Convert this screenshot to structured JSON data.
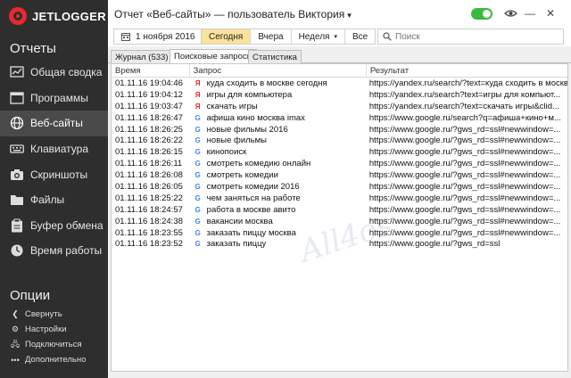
{
  "app": {
    "logo_text": "JETLOGGER"
  },
  "sidebar": {
    "reports_title": "Отчеты",
    "items": [
      {
        "label": "Общая сводка",
        "icon": "summary-icon",
        "active": false
      },
      {
        "label": "Программы",
        "icon": "programs-icon",
        "active": false
      },
      {
        "label": "Веб-сайты",
        "icon": "globe-icon",
        "active": true
      },
      {
        "label": "Клавиатура",
        "icon": "keyboard-icon",
        "active": false
      },
      {
        "label": "Скриншоты",
        "icon": "camera-icon",
        "active": false
      },
      {
        "label": "Файлы",
        "icon": "folder-icon",
        "active": false
      },
      {
        "label": "Буфер обмена",
        "icon": "clipboard-icon",
        "active": false
      },
      {
        "label": "Время работы",
        "icon": "clock-icon",
        "active": false
      }
    ],
    "options_title": "Опции",
    "options": [
      {
        "label": "Свернуть",
        "icon": "chevron-left-icon"
      },
      {
        "label": "Настройки",
        "icon": "gear-icon"
      },
      {
        "label": "Подключиться",
        "icon": "connect-icon"
      },
      {
        "label": "Дополнительно",
        "icon": "more-icon"
      }
    ]
  },
  "header": {
    "title": "Отчет «Веб-сайты» — пользователь ",
    "user": "Виктория",
    "toggle_on": true,
    "accent": "#3cb93c"
  },
  "toolbar": {
    "date": "1 ноября 2016",
    "today": "Сегодня",
    "yesterday": "Вчера",
    "week": "Неделя",
    "all": "Все",
    "search_placeholder": "Поиск",
    "active_color": "#fbe29a"
  },
  "tabs": [
    {
      "label": "Журнал (533)",
      "active": false
    },
    {
      "label": "Поисковые запросы",
      "active": true
    },
    {
      "label": "Статистика",
      "active": false
    }
  ],
  "table": {
    "columns": [
      "Время",
      "Запрос",
      "Результат"
    ],
    "rows": [
      {
        "time": "01.11.16 19:04:46",
        "engine": "yandex",
        "query": "куда сходить в москве сегодня",
        "result": "https://yandex.ru/search/?text=куда сходить в москве"
      },
      {
        "time": "01.11.16 19:04:12",
        "engine": "yandex",
        "query": "игры для компьютера",
        "result": "https://yandex.ru/search?text=игры для компьют..."
      },
      {
        "time": "01.11.16 19:03:47",
        "engine": "yandex",
        "query": "скачать игры",
        "result": "https://yandex.ru/search?text=скачать игры&clid..."
      },
      {
        "time": "01.11.16 18:26:47",
        "engine": "google",
        "query": "афиша кино москва imax",
        "result": "https://www.google.ru/search?q=афиша+кино+м..."
      },
      {
        "time": "01.11.16 18:26:25",
        "engine": "google",
        "query": "новые фильмы 2016",
        "result": "https://www.google.ru/?gws_rd=ssl#newwindow=..."
      },
      {
        "time": "01.11.16 18:26:22",
        "engine": "google",
        "query": "новые фильмы",
        "result": "https://www.google.ru/?gws_rd=ssl#newwindow=..."
      },
      {
        "time": "01.11.16 18:26:15",
        "engine": "google",
        "query": "кинопоиск",
        "result": "https://www.google.ru/?gws_rd=ssl#newwindow=..."
      },
      {
        "time": "01.11.16 18:26:11",
        "engine": "google",
        "query": "смотреть комедию онлайн",
        "result": "https://www.google.ru/?gws_rd=ssl#newwindow=..."
      },
      {
        "time": "01.11.16 18:26:08",
        "engine": "google",
        "query": "смотреть комедии",
        "result": "https://www.google.ru/?gws_rd=ssl#newwindow=..."
      },
      {
        "time": "01.11.16 18:26:05",
        "engine": "google",
        "query": "смотреть комедии 2016",
        "result": "https://www.google.ru/?gws_rd=ssl#newwindow=..."
      },
      {
        "time": "01.11.16 18:25:22",
        "engine": "google",
        "query": "чем заняться на работе",
        "result": "https://www.google.ru/?gws_rd=ssl#newwindow=..."
      },
      {
        "time": "01.11.16 18:24:57",
        "engine": "google",
        "query": "работа в москве авито",
        "result": "https://www.google.ru/?gws_rd=ssl#newwindow=..."
      },
      {
        "time": "01.11.16 18:24:38",
        "engine": "google",
        "query": "вакансии москва",
        "result": "https://www.google.ru/?gws_rd=ssl#newwindow=..."
      },
      {
        "time": "01.11.16 18:23:55",
        "engine": "google",
        "query": "заказать пиццу москва",
        "result": "https://www.google.ru/?gws_rd=ssl#newwindow=..."
      },
      {
        "time": "01.11.16 18:23:52",
        "engine": "google",
        "query": "заказать пиццу",
        "result": "https://www.google.ru/?gws_rd=ssl"
      }
    ]
  },
  "watermark": "All4os"
}
